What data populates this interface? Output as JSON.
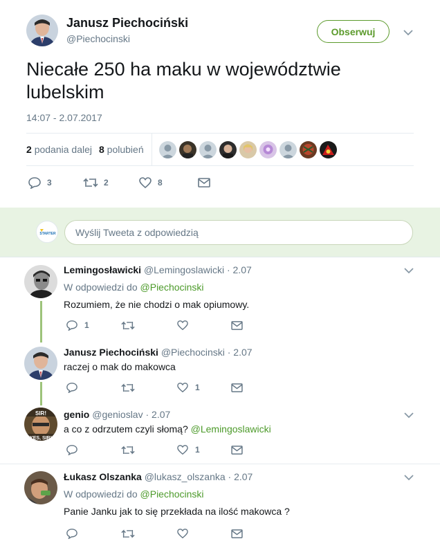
{
  "tweet": {
    "author_name": "Janusz Piechociński",
    "author_handle": "@Piechocinski",
    "follow_label": "Obserwuj",
    "text": "Niecałe 250 ha maku w województwie lubelskim",
    "time": "14:07 - 2.07.2017",
    "retweets_count": "2",
    "retweets_label": "podania dalej",
    "likes_count": "8",
    "likes_label": "polubień",
    "actions": {
      "reply_count": "3",
      "retweet_count": "2",
      "like_count": "8"
    }
  },
  "reply_box": {
    "placeholder": "Wyślij Tweeta z odpowiedzią",
    "logo_text": "STARTER"
  },
  "replies": [
    {
      "name": "Lemingosławicki",
      "meta": "@Lemingoslawicki · 2.07",
      "context_prefix": "W odpowiedzi do",
      "context_mention": "@Piechocinski",
      "text": "Rozumiem, że nie chodzi o mak opiumowy.",
      "reply_count": "1",
      "retweet_count": "",
      "like_count": ""
    },
    {
      "name": "Janusz Piechociński",
      "meta": "@Piechocinski · 2.07",
      "text": "raczej o mak do makowca",
      "reply_count": "",
      "retweet_count": "",
      "like_count": "1"
    },
    {
      "name": "genio",
      "meta": "@genioslav · 2.07",
      "text": "a co z odrzutem czyli słomą?",
      "text_mention": "@Lemingoslawicki",
      "avatar_top": "SIR!",
      "avatar_bottom": "YES, SIR!",
      "reply_count": "",
      "retweet_count": "",
      "like_count": "1"
    },
    {
      "name": "Łukasz Olszanka",
      "meta": "@lukasz_olszanka · 2.07",
      "context_prefix": "W odpowiedzi do",
      "context_mention": "@Piechocinski",
      "text": "Panie Janku jak to się przekłada na ilość makowca ?",
      "reply_count": "",
      "retweet_count": "",
      "like_count": ""
    }
  ],
  "colors": {
    "accent": "#5b9a2b",
    "mention": "#4c9a2a",
    "muted": "#657786",
    "reply_bg": "#e8f3e3",
    "thread": "#9dc37a"
  }
}
